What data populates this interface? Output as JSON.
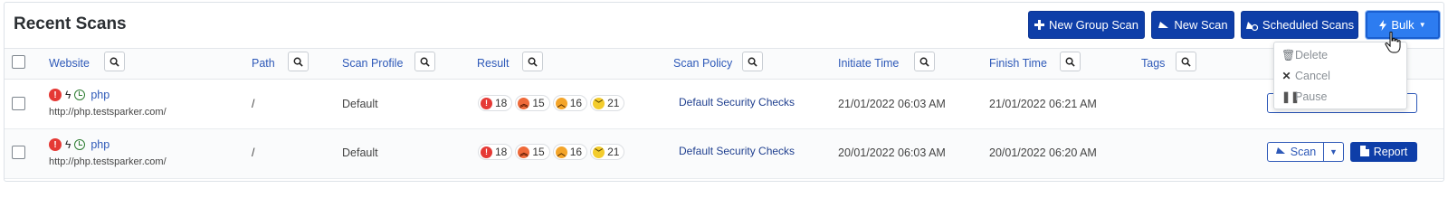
{
  "title": "Recent Scans",
  "toolbar": {
    "new_group_scan": "New Group Scan",
    "new_scan": "New Scan",
    "scheduled_scans": "Scheduled Scans",
    "bulk": "Bulk"
  },
  "bulk_menu": {
    "delete": "Delete",
    "cancel": "Cancel",
    "pause": "Pause"
  },
  "columns": {
    "website": "Website",
    "path": "Path",
    "scan_profile": "Scan Profile",
    "result": "Result",
    "scan_policy": "Scan Policy",
    "initiate_time": "Initiate Time",
    "finish_time": "Finish Time",
    "tags": "Tags"
  },
  "rows": [
    {
      "name": "php",
      "url": "http://php.testsparker.com/",
      "path": "/",
      "profile": "Default",
      "critical": "18",
      "high": "15",
      "medium": "16",
      "low": "21",
      "policy": "Default Security Checks",
      "initiated": "21/01/2022 06:03 AM",
      "finished": "21/01/2022 06:21 AM"
    },
    {
      "name": "php",
      "url": "http://php.testsparker.com/",
      "path": "/",
      "profile": "Default",
      "critical": "18",
      "high": "15",
      "medium": "16",
      "low": "21",
      "policy": "Default Security Checks",
      "initiated": "20/01/2022 06:03 AM",
      "finished": "20/01/2022 06:20 AM"
    }
  ],
  "actions": {
    "scan": "Scan",
    "report": "Report"
  },
  "colors": {
    "primary": "#0e3ea8",
    "bulk_active": "#2d7cf0",
    "link": "#2e59b8",
    "critical": "#e53935",
    "high": "#ef6a3a",
    "medium": "#f4a52a",
    "low": "#f3cc2d"
  }
}
